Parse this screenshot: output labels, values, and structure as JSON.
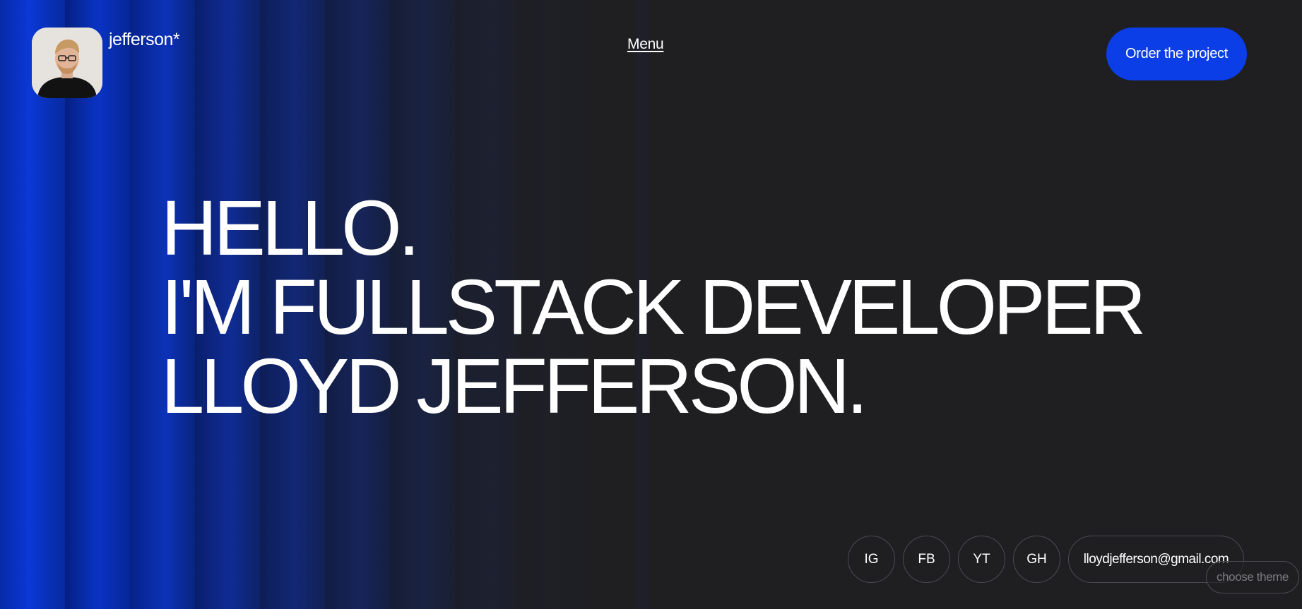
{
  "header": {
    "brand": "jefferson*",
    "menu_label": "Menu",
    "order_label": "Order the project"
  },
  "hero": {
    "lines": [
      "HELLO.",
      "I'M FULLSTACK DEVELOPER",
      "LLOYD JEFFERSON."
    ]
  },
  "socials": [
    {
      "label": "IG",
      "icon": "instagram"
    },
    {
      "label": "FB",
      "icon": "facebook"
    },
    {
      "label": "YT",
      "icon": "youtube"
    },
    {
      "label": "GH",
      "icon": "github"
    }
  ],
  "email": "lloydjefferson@gmail.com",
  "theme_label": "choose theme",
  "colors": {
    "background": "#1f1f22",
    "accent": "#0b3ee6",
    "stripe_blue": "#0a34c8"
  }
}
